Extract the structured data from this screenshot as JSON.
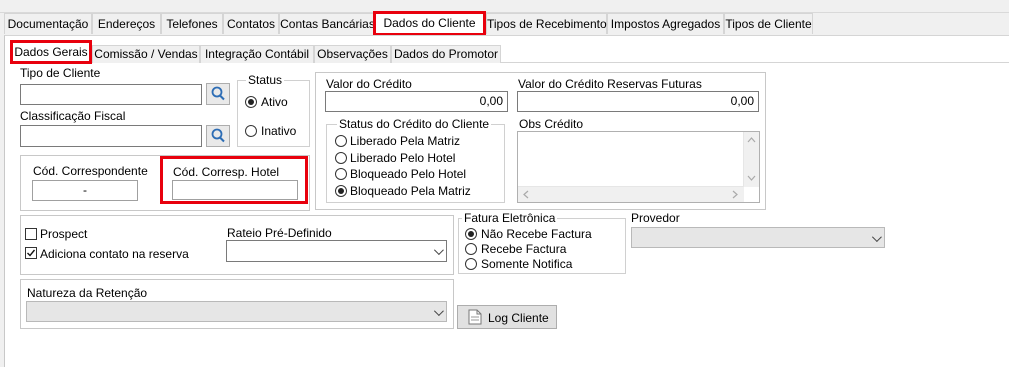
{
  "tabs": [
    {
      "label": "Documentação"
    },
    {
      "label": "Endereços"
    },
    {
      "label": "Telefones"
    },
    {
      "label": "Contatos"
    },
    {
      "label": "Contas Bancárias"
    },
    {
      "label": "Dados do Cliente"
    },
    {
      "label": "Tipos de Recebimento"
    },
    {
      "label": "Impostos Agregados"
    },
    {
      "label": "Tipos de Cliente"
    }
  ],
  "subtabs": [
    {
      "label": "Dados Gerais"
    },
    {
      "label": "Comissão / Vendas"
    },
    {
      "label": "Integração Contábil"
    },
    {
      "label": "Observações"
    },
    {
      "label": "Dados do Promotor"
    }
  ],
  "form": {
    "tipo_cliente_label": "Tipo de Cliente",
    "tipo_cliente_value": "",
    "classificacao_label": "Classificação Fiscal",
    "classificacao_value": "",
    "status_label": "Status",
    "status_ativo": "Ativo",
    "status_inativo": "Inativo",
    "cod_corresp_label": "Cód. Correspondente",
    "cod_corresp_value": "-",
    "cod_hotel_label": "Cód. Corresp. Hotel",
    "cod_hotel_value": "",
    "valor_credito_label": "Valor do Crédito",
    "valor_credito_value": "0,00",
    "valor_reservas_label": "Valor do Crédito Reservas Futuras",
    "valor_reservas_value": "0,00",
    "status_credito_label": "Status do Crédito do Cliente",
    "status_credito_options": [
      "Liberado Pela Matriz",
      "Liberado Pelo Hotel",
      "Bloqueado Pelo Hotel",
      "Bloqueado Pela Matriz"
    ],
    "obs_credito_label": "Obs Crédito",
    "prospect_label": "Prospect",
    "adiciona_label": "Adiciona contato na reserva",
    "rateio_label": "Rateio Pré-Definido",
    "fatura_label": "Fatura Eletrônica",
    "fatura_options": [
      "Não Recebe Factura",
      "Recebe Factura",
      "Somente Notifica"
    ],
    "provedor_label": "Provedor",
    "natureza_label": "Natureza da Retenção",
    "log_button": "Log Cliente"
  }
}
